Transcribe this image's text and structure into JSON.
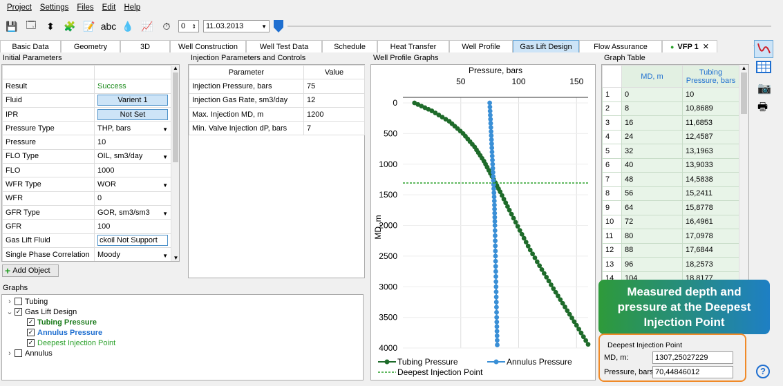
{
  "menu": [
    "Project",
    "Settings",
    "Files",
    "Edit",
    "Help"
  ],
  "toolbar": {
    "spin_value": "0",
    "date": "11.03.2013"
  },
  "tabs": [
    "Basic Data",
    "Geometry",
    "3D",
    "Well Construction",
    "Well Test Data",
    "Schedule",
    "Heat Transfer",
    "Well Profile",
    "Gas Lift Design",
    "Flow Assurance",
    "VFP 1"
  ],
  "active_tab": "Gas Lift Design",
  "initial": {
    "title": "Initial Parameters",
    "rows": [
      {
        "k": "Result",
        "v": "Success",
        "kind": "green"
      },
      {
        "k": "Fluid",
        "v": "Varient 1",
        "kind": "btn"
      },
      {
        "k": "IPR",
        "v": "Not Set",
        "kind": "btn"
      },
      {
        "k": "Pressure Type",
        "v": "THP, bars",
        "kind": "dd"
      },
      {
        "k": "Pressure",
        "v": "10",
        "kind": "t"
      },
      {
        "k": "FLO Type",
        "v": "OIL, sm3/day",
        "kind": "dd"
      },
      {
        "k": "FLO",
        "v": "1000",
        "kind": "t"
      },
      {
        "k": "WFR Type",
        "v": "WOR",
        "kind": "dd"
      },
      {
        "k": "WFR",
        "v": "0",
        "kind": "t"
      },
      {
        "k": "GFR Type",
        "v": "GOR, sm3/sm3",
        "kind": "dd"
      },
      {
        "k": "GFR",
        "v": "100",
        "kind": "t"
      },
      {
        "k": "Gas Lift Fluid",
        "v": "ckoil Not Support",
        "kind": "inp"
      },
      {
        "k": "Single Phase Correlation",
        "v": "Moody",
        "kind": "dd"
      }
    ],
    "add_btn": "Add Object"
  },
  "inj": {
    "title": "Injection Parameters and Controls",
    "h1": "Parameter",
    "h2": "Value",
    "rows": [
      {
        "k": "Injection Pressure, bars",
        "v": "75"
      },
      {
        "k": "Injection Gas Rate, sm3/day",
        "v": "12"
      },
      {
        "k": "Max. Injection MD, m",
        "v": "1200"
      },
      {
        "k": "Min. Valve Injection dP, bars",
        "v": "7"
      }
    ]
  },
  "graphs": {
    "title": "Graphs",
    "items": [
      {
        "label": "Tubing",
        "checked": false,
        "level": 0,
        "color": "#000"
      },
      {
        "label": "Gas Lift Design",
        "checked": true,
        "level": 0,
        "color": "#000"
      },
      {
        "label": "Tubing Pressure",
        "checked": true,
        "level": 1,
        "color": "#1a7a1a"
      },
      {
        "label": "Annulus Pressure",
        "checked": true,
        "level": 1,
        "color": "#1f6fd0"
      },
      {
        "label": "Deepest Injection Point",
        "checked": true,
        "level": 1,
        "color": "#2aa02a"
      },
      {
        "label": "Annulus",
        "checked": false,
        "level": 0,
        "color": "#000"
      }
    ]
  },
  "profile": {
    "title": "Well Profile Graphs"
  },
  "chart_data": {
    "type": "line",
    "xlabel": "Pressure, bars",
    "ylabel": "MD, m",
    "xlim": [
      0,
      160
    ],
    "ylim": [
      4000,
      0
    ],
    "xticks": [
      "50",
      "100",
      "150"
    ],
    "yticks": [
      "0",
      "500",
      "1000",
      "1500",
      "2000",
      "2500",
      "3000",
      "3500",
      "4000"
    ],
    "series": [
      {
        "name": "Tubing Pressure",
        "color": "#1e6b2a",
        "x": [
          10,
          25,
          40,
          52,
          62,
          70,
          77,
          84,
          92,
          101,
          110,
          120,
          130,
          140,
          150,
          160
        ],
        "y": [
          0,
          130,
          300,
          500,
          720,
          950,
          1200,
          1450,
          1750,
          2080,
          2400,
          2720,
          3030,
          3330,
          3630,
          3940
        ]
      },
      {
        "name": "Annulus Pressure",
        "color": "#3a8fd6",
        "x": [
          75,
          76,
          77,
          78,
          79,
          79.5,
          80,
          80.5,
          81,
          81.5
        ],
        "y": [
          0,
          400,
          800,
          1200,
          1600,
          2000,
          2500,
          3000,
          3500,
          3950
        ]
      },
      {
        "name": "Deepest Injection Point",
        "color": "#2aa02a",
        "x": [
          0,
          160
        ],
        "y": [
          1307,
          1307
        ]
      }
    ]
  },
  "gtable": {
    "title": "Graph Table",
    "h1": "MD, m",
    "h2": "Tubing Pressure, bars",
    "rows": [
      [
        "1",
        "0",
        "10"
      ],
      [
        "2",
        "8",
        "10,8689"
      ],
      [
        "3",
        "16",
        "11,6853"
      ],
      [
        "4",
        "24",
        "12,4587"
      ],
      [
        "5",
        "32",
        "13,1963"
      ],
      [
        "6",
        "40",
        "13,9033"
      ],
      [
        "7",
        "48",
        "14,5838"
      ],
      [
        "8",
        "56",
        "15,2411"
      ],
      [
        "9",
        "64",
        "15,8778"
      ],
      [
        "10",
        "72",
        "16,4961"
      ],
      [
        "11",
        "80",
        "17,0978"
      ],
      [
        "12",
        "88",
        "17,6844"
      ],
      [
        "13",
        "96",
        "18,2573"
      ],
      [
        "14",
        "104",
        "18,8177"
      ]
    ]
  },
  "callout": [
    "Measured depth and",
    "pressure at the Deepest",
    "Injection Point"
  ],
  "dip": {
    "title": "Deepest Injection Point",
    "md_label": "MD, m:",
    "md": "1307,25027229",
    "p_label": "Pressure, bars:",
    "p": "70,44846012"
  }
}
